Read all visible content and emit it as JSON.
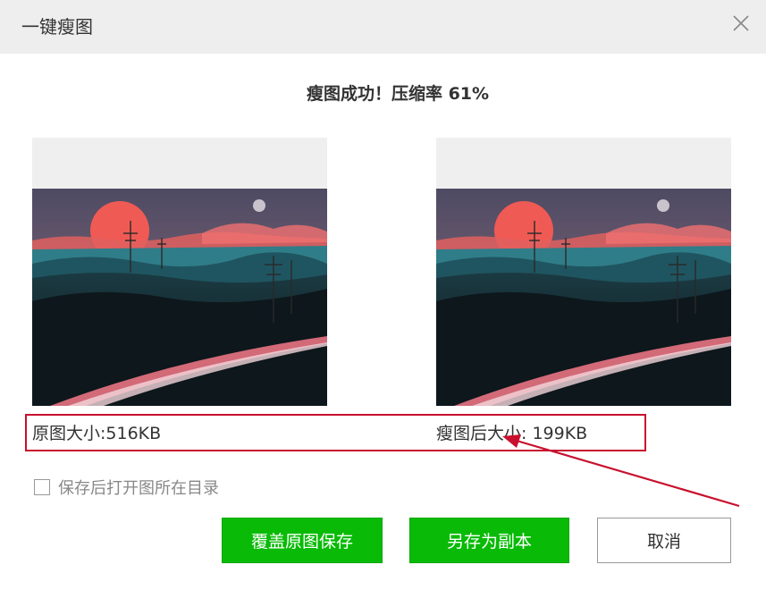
{
  "window": {
    "title": "一键瘦图",
    "close_icon": "close-icon"
  },
  "result": {
    "message": "瘦图成功！压缩率 61%"
  },
  "images": {
    "original": {
      "size_label": "原图大小:516KB"
    },
    "compressed": {
      "size_label": "瘦图后大小: 199KB"
    }
  },
  "options": {
    "open_folder_label": "保存后打开图所在目录",
    "open_folder_checked": false
  },
  "buttons": {
    "overwrite_label": "覆盖原图保存",
    "save_copy_label": "另存为副本",
    "cancel_label": "取消"
  },
  "colors": {
    "primary_button": "#09bb07",
    "annotation": "#c8102e",
    "titlebar": "#eeeeee"
  }
}
